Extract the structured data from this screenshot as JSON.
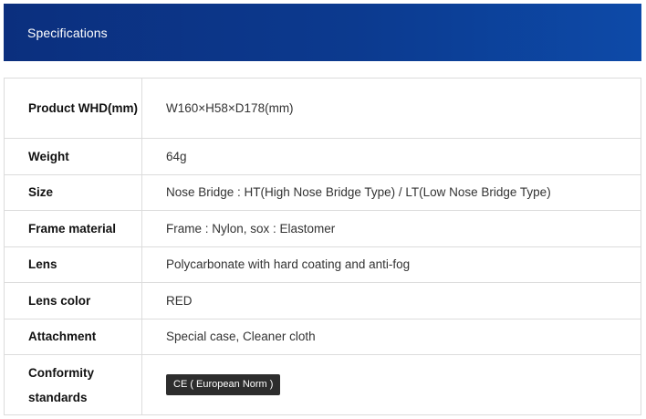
{
  "header": {
    "title": "Specifications"
  },
  "specs": [
    {
      "label": "Product WHD(mm)",
      "value": "W160×H58×D178(mm)"
    },
    {
      "label": "Weight",
      "value": "64g"
    },
    {
      "label": "Size",
      "value": "Nose Bridge : HT(High Nose Bridge Type) / LT(Low Nose Bridge Type)"
    },
    {
      "label": "Frame material",
      "value": "Frame : Nylon, sox : Elastomer"
    },
    {
      "label": "Lens",
      "value": "Polycarbonate with hard coating and anti-fog"
    },
    {
      "label": "Lens color",
      "value": "RED"
    },
    {
      "label": "Attachment",
      "value": "Special case, Cleaner cloth"
    },
    {
      "label": "Conformity standards",
      "badge": "CE ( European Norm )"
    }
  ]
}
